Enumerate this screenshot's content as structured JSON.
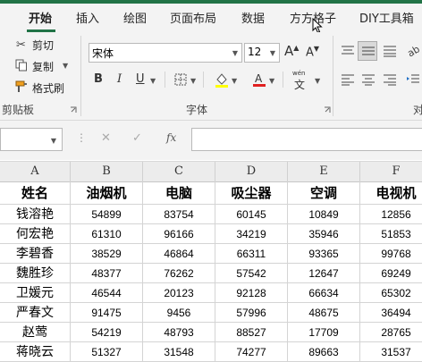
{
  "tabs": [
    "开始",
    "插入",
    "绘图",
    "页面布局",
    "数据",
    "方方格子",
    "DIY工具箱"
  ],
  "clipboard": {
    "cut": "剪切",
    "copy": "复制",
    "format_painter": "格式刷",
    "group_label": "剪贴板"
  },
  "font": {
    "name": "宋体",
    "size": "12",
    "grow": "A",
    "shrink": "A",
    "bold": "B",
    "italic": "I",
    "underline": "U",
    "group_label": "字体",
    "phonetic": "wén",
    "phonetic_char": "文"
  },
  "alignment": {
    "partial_label": "对"
  },
  "formula_bar": {
    "fx": "fx",
    "cancel": "✕",
    "confirm": "✓"
  },
  "columns": [
    "A",
    "B",
    "C",
    "D",
    "E",
    "F"
  ],
  "table": {
    "headers": [
      "姓名",
      "油烟机",
      "电脑",
      "吸尘器",
      "空调",
      "电视机"
    ],
    "rows": [
      [
        "钱溶艳",
        "54899",
        "83754",
        "60145",
        "10849",
        "12856"
      ],
      [
        "何宏艳",
        "61310",
        "96166",
        "34219",
        "35946",
        "51853"
      ],
      [
        "李碧香",
        "38529",
        "46864",
        "66311",
        "93365",
        "99768"
      ],
      [
        "魏胜珍",
        "48377",
        "76262",
        "57542",
        "12647",
        "69249"
      ],
      [
        "卫媛元",
        "46544",
        "20123",
        "92128",
        "66634",
        "65302"
      ],
      [
        "严春文",
        "91475",
        "9456",
        "57996",
        "48675",
        "36494"
      ],
      [
        "赵莺",
        "54219",
        "48793",
        "88527",
        "17709",
        "28765"
      ],
      [
        "蒋晓云",
        "51327",
        "31548",
        "74277",
        "89663",
        "31537"
      ]
    ]
  },
  "colors": {
    "accent": "#217346",
    "font_color": "#e02020",
    "highlight": "#ffff00"
  }
}
